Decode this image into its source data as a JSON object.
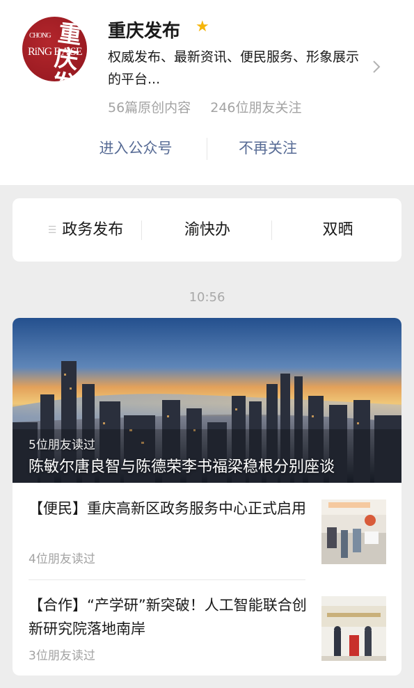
{
  "account": {
    "logo_text_top": "CHONG",
    "logo_text_mid": "RiNG E A SE",
    "logo_text_cn": "重庆 发布",
    "name": "重庆发布",
    "verified_icon": "star-icon",
    "description": "权威发布、最新资讯、便民服务、形象展示的平台...",
    "original_count": "56篇原创内容",
    "followers": "246位朋友关注",
    "chevron_icon": "chevron-right-icon"
  },
  "actions": {
    "enter_label": "进入公众号",
    "unfollow_label": "不再关注"
  },
  "menu": {
    "items": [
      {
        "label": "政务发布",
        "icon": "menu-bars-icon"
      },
      {
        "label": "渝快办"
      },
      {
        "label": "双晒"
      }
    ]
  },
  "timeline": {
    "time": "10:56"
  },
  "feed": {
    "hero": {
      "read_info": "5位朋友读过",
      "title": "陈敏尔唐良智与陈德荣李书福梁稳根分别座谈"
    },
    "articles": [
      {
        "title": "【便民】重庆高新区政务服务中心正式启用",
        "read_info": "4位朋友读过"
      },
      {
        "title": "【合作】“产学研”新突破！人工智能联合创新研究院落地南岸",
        "read_info": "3位朋友读过"
      }
    ]
  },
  "colors": {
    "link": "#576b95",
    "star": "#f5b50a",
    "logo_red": "#9b1b22",
    "page_bg": "#ededed"
  }
}
